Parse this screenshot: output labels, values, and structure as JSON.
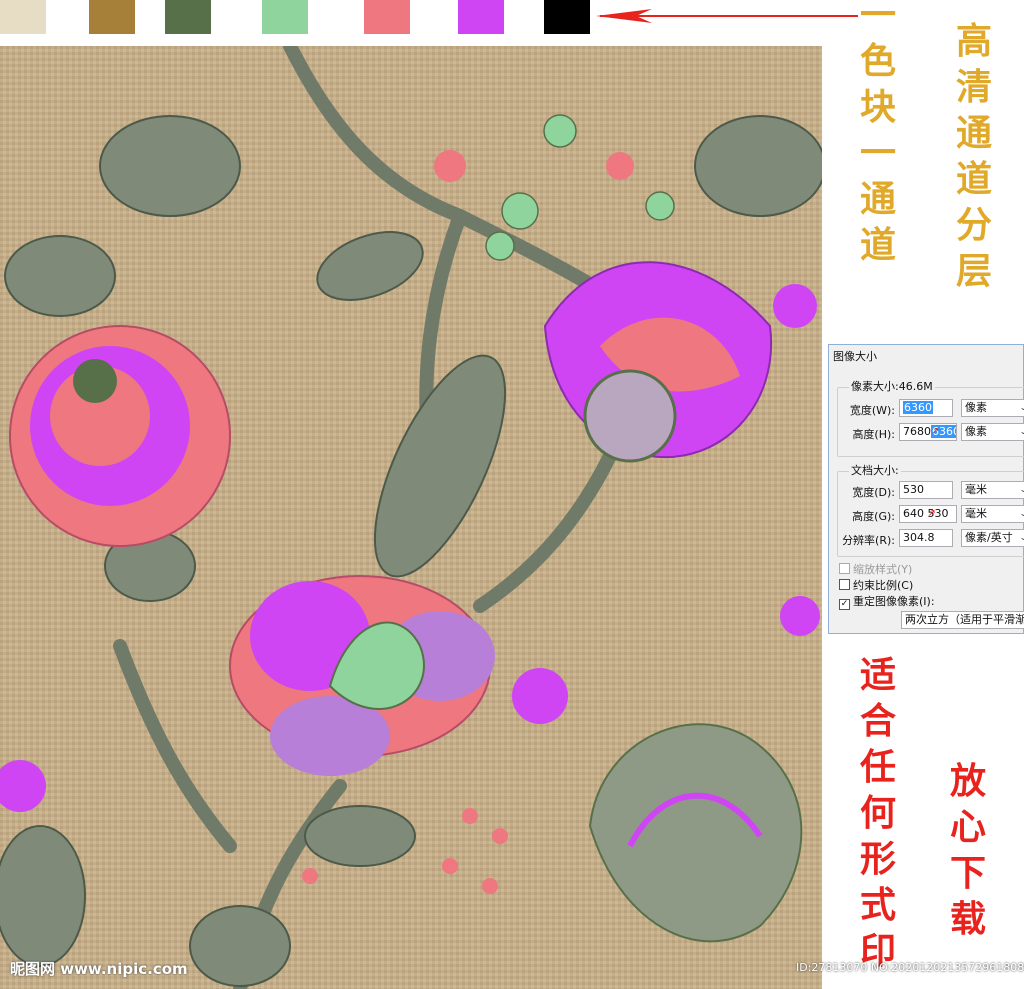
{
  "swatches": {
    "colors": [
      "#e7dcc4",
      "#a67f38",
      "#58704a",
      "#8ed49c",
      "#ee7780",
      "#cf45f4",
      "#000000"
    ]
  },
  "side_text": {
    "col1": [
      "一",
      "色",
      "块",
      "一",
      "通",
      "道"
    ],
    "col2": [
      "高",
      "清",
      "通",
      "道",
      "分",
      "层"
    ],
    "col3": [
      "适",
      "合",
      "任",
      "何",
      "形",
      "式",
      "印"
    ],
    "col4": [
      "放",
      "心",
      "下",
      "载"
    ]
  },
  "dialog": {
    "title": "图像大小",
    "pixel_group_label": "像素大小:46.6M",
    "width_label": "宽度(W):",
    "width_value": "6360",
    "width_unit": "像素",
    "height_label": "高度(H):",
    "height_value_old": "7680",
    "height_value_new": "6360",
    "height_unit": "像素",
    "doc_group_label": "文档大小:",
    "doc_width_label": "宽度(D):",
    "doc_width_value": "530",
    "doc_width_unit": "毫米",
    "doc_height_label": "高度(G):",
    "doc_height_value_old": "640",
    "doc_height_value_new": "530",
    "doc_height_unit": "毫米",
    "resolution_label": "分辨率(R):",
    "resolution_value": "304.8",
    "resolution_unit": "像素/英寸",
    "scale_styles_label": "缩放样式(Y)",
    "constrain_label": "约束比例(C)",
    "resample_label": "重定图像像素(I):",
    "resample_method": "两次立方（适用于平滑渐变"
  },
  "watermark": {
    "site": "昵图网 www.nipic.com",
    "id_text": "ID:27813070 NO:20201202135729618088"
  }
}
